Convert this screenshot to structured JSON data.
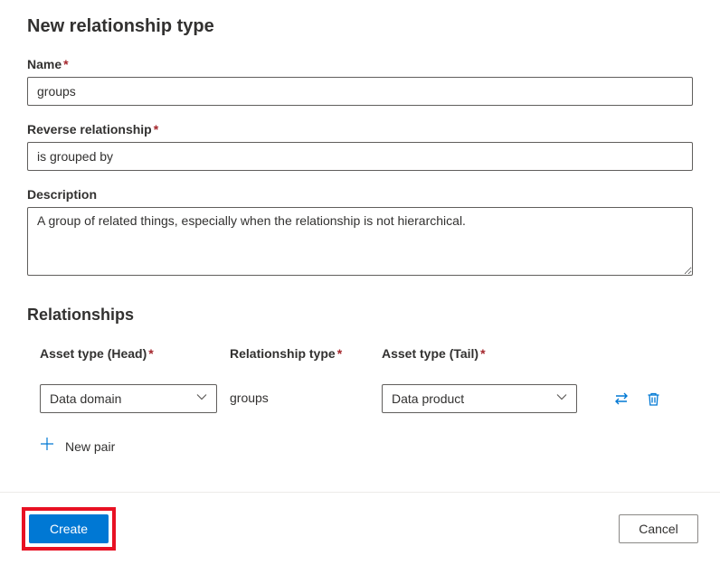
{
  "page_title": "New relationship type",
  "fields": {
    "name": {
      "label": "Name",
      "value": "groups",
      "required": true
    },
    "reverse": {
      "label": "Reverse relationship",
      "value": "is grouped by",
      "required": true
    },
    "description": {
      "label": "Description",
      "value": "A group of related things, especially when the relationship is not hierarchical.",
      "required": false
    }
  },
  "relationships": {
    "section_title": "Relationships",
    "headers": {
      "head": "Asset type (Head)",
      "type": "Relationship type",
      "tail": "Asset type (Tail)"
    },
    "row": {
      "head_value": "Data domain",
      "type_value": "groups",
      "tail_value": "Data product"
    },
    "new_pair_label": "New pair"
  },
  "actions": {
    "create": "Create",
    "cancel": "Cancel"
  },
  "required_marker": "*"
}
